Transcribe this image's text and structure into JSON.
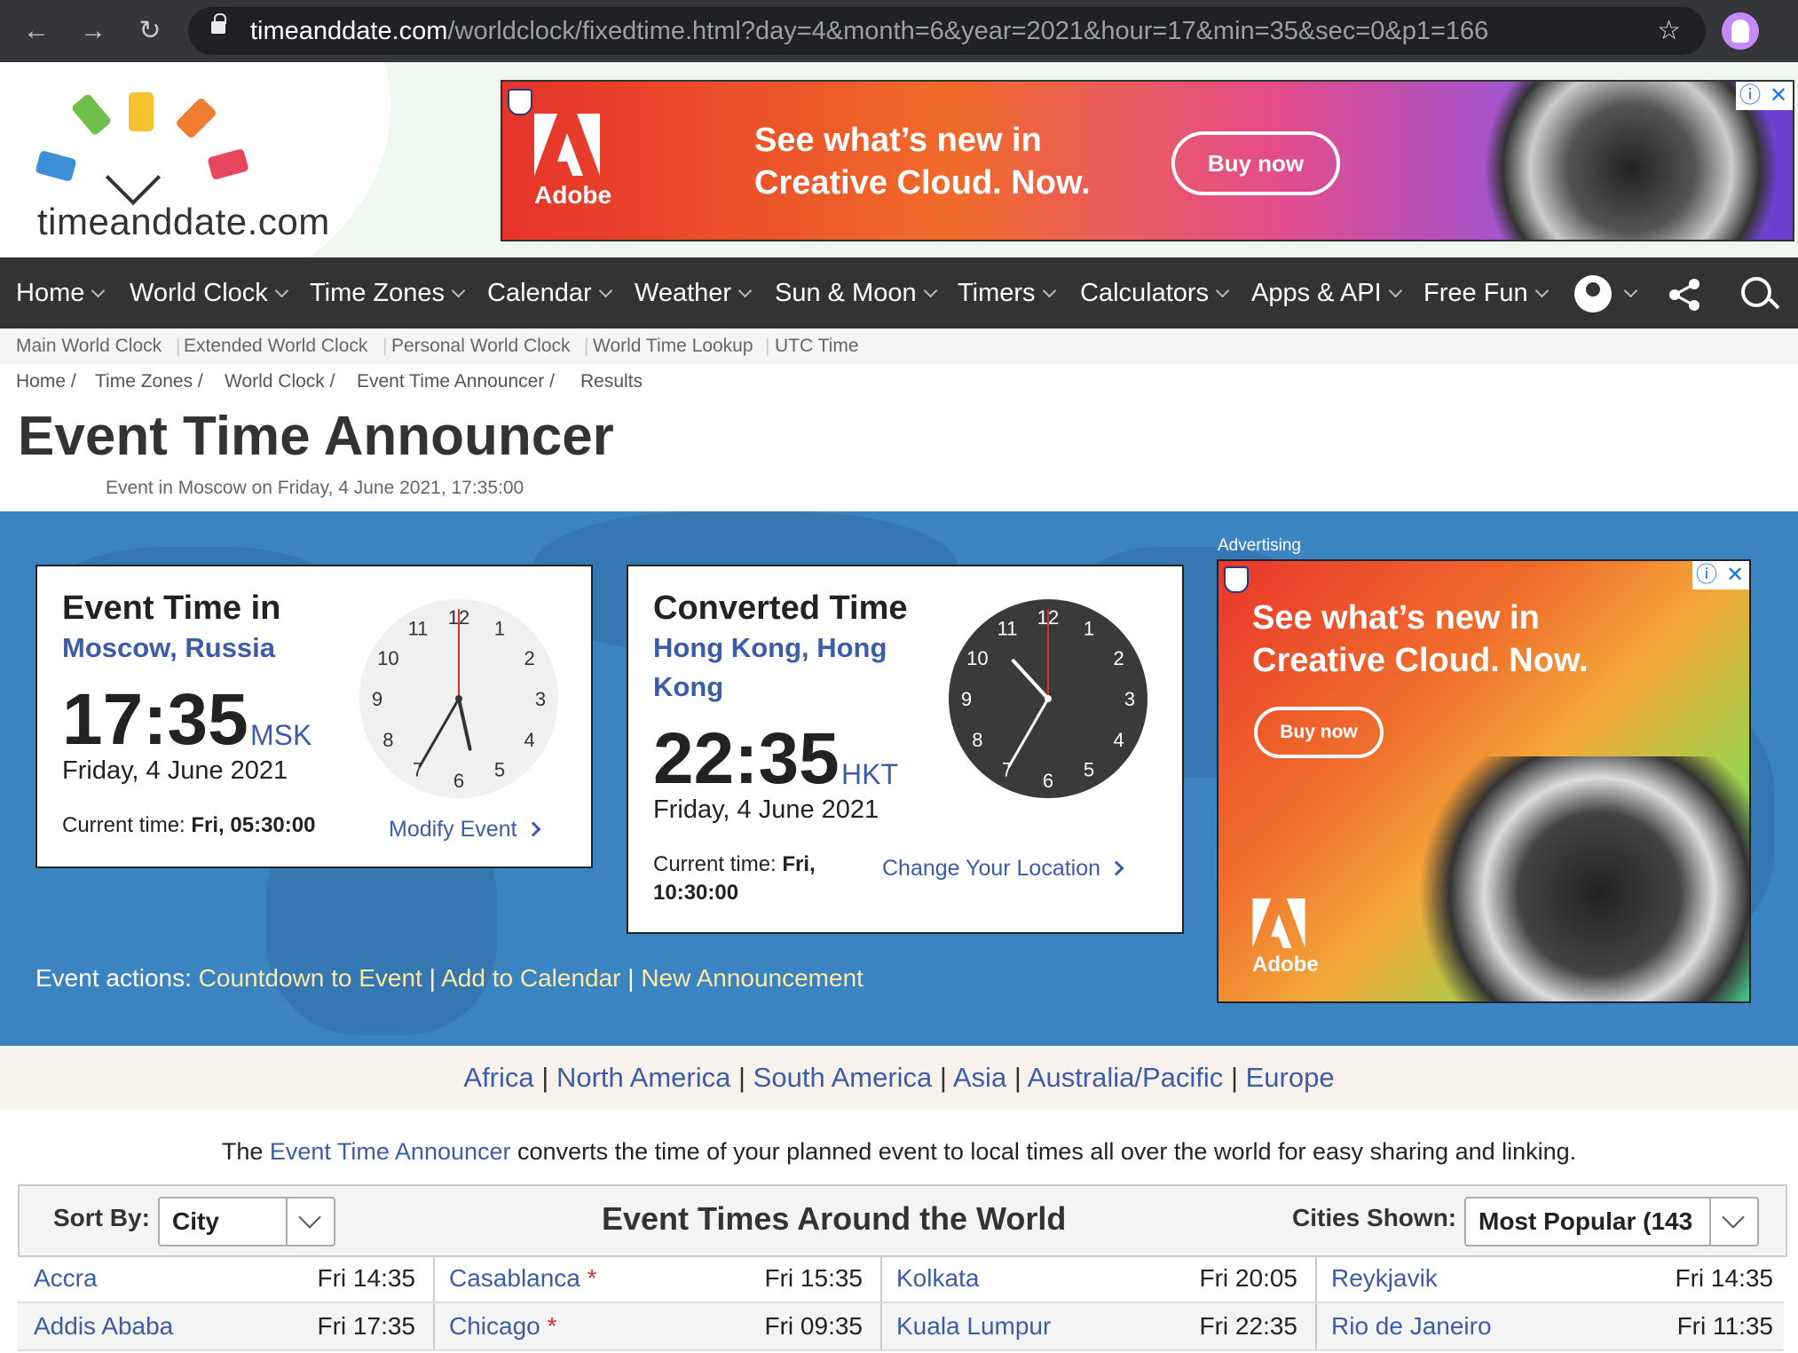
{
  "browser": {
    "url_domain": "timeanddate.com",
    "url_path": "/worldclock/fixedtime.html?day=4&month=6&year=2021&hour=17&min=35&sec=0&p1=166"
  },
  "site": {
    "logo_text": "timeanddate.com"
  },
  "ads": {
    "top": {
      "brand": "Adobe",
      "headline_1": "See what’s new in",
      "headline_2": "Creative Cloud. Now.",
      "button": "Buy now"
    },
    "side": {
      "label": "Advertising",
      "brand": "Adobe",
      "headline_1": "See what’s new in",
      "headline_2": "Creative Cloud. Now.",
      "button": "Buy now"
    }
  },
  "nav": {
    "items": [
      "Home",
      "World Clock",
      "Time Zones",
      "Calendar",
      "Weather",
      "Sun & Moon",
      "Timers",
      "Calculators",
      "Apps & API",
      "Free Fun"
    ]
  },
  "subnav": [
    "Main World Clock",
    "Extended World Clock",
    "Personal World Clock",
    "World Time Lookup",
    "UTC Time"
  ],
  "breadcrumb": [
    "Home /",
    "Time Zones /",
    "World Clock /",
    "Event Time Announcer /",
    "Results"
  ],
  "page": {
    "title": "Event Time Announcer",
    "subtitle": "Event in Moscow on Friday, 4 June 2021, 17:35:00"
  },
  "event_card": {
    "heading": "Event Time in",
    "location": "Moscow, Russia",
    "time": "17:35",
    "tz": "MSK",
    "date": "Friday, 4 June 2021",
    "current_label": "Current time:",
    "current_value": "Fri, 05:30:00",
    "action": "Modify Event",
    "clock": {
      "hour": 17,
      "minute": 35,
      "dark": false
    }
  },
  "converted_card": {
    "heading": "Converted Time",
    "location_1": "Hong Kong, Hong",
    "location_2": "Kong",
    "time": "22:35",
    "tz": "HKT",
    "date": "Friday, 4 June 2021",
    "current_label": "Current time:",
    "current_value_1": "Fri,",
    "current_value_2": "10:30:00",
    "action": "Change Your Location",
    "clock": {
      "hour": 22,
      "minute": 35,
      "dark": true
    }
  },
  "clock_numbers": [
    "12",
    "1",
    "2",
    "3",
    "4",
    "5",
    "6",
    "7",
    "8",
    "9",
    "10",
    "11"
  ],
  "event_actions": {
    "label": "Event actions:",
    "links": [
      "Countdown to Event",
      "Add to Calendar",
      "New Announcement"
    ],
    "sep": "|"
  },
  "continents": [
    "Africa",
    "North America",
    "South America",
    "Asia",
    "Australia/Pacific",
    "Europe"
  ],
  "intro": {
    "pre": "The ",
    "link": "Event Time Announcer",
    "post": " converts the time of your planned event to local times all over the world for easy sharing and linking."
  },
  "table": {
    "sort_label": "Sort By:",
    "sort_value": "City",
    "title": "Event Times Around the World",
    "cities_label": "Cities Shown:",
    "cities_value": "Most Popular (143",
    "dst_mark": "*",
    "rows": [
      [
        {
          "city": "Accra",
          "time": "Fri 14:35",
          "dst": false
        },
        {
          "city": "Casablanca",
          "time": "Fri 15:35",
          "dst": true
        },
        {
          "city": "Kolkata",
          "time": "Fri 20:05",
          "dst": false
        },
        {
          "city": "Reykjavik",
          "time": "Fri 14:35",
          "dst": false
        }
      ],
      [
        {
          "city": "Addis Ababa",
          "time": "Fri 17:35",
          "dst": false
        },
        {
          "city": "Chicago",
          "time": "Fri 09:35",
          "dst": true
        },
        {
          "city": "Kuala Lumpur",
          "time": "Fri 22:35",
          "dst": false
        },
        {
          "city": "Rio de Janeiro",
          "time": "Fri 11:35",
          "dst": false
        }
      ]
    ]
  }
}
